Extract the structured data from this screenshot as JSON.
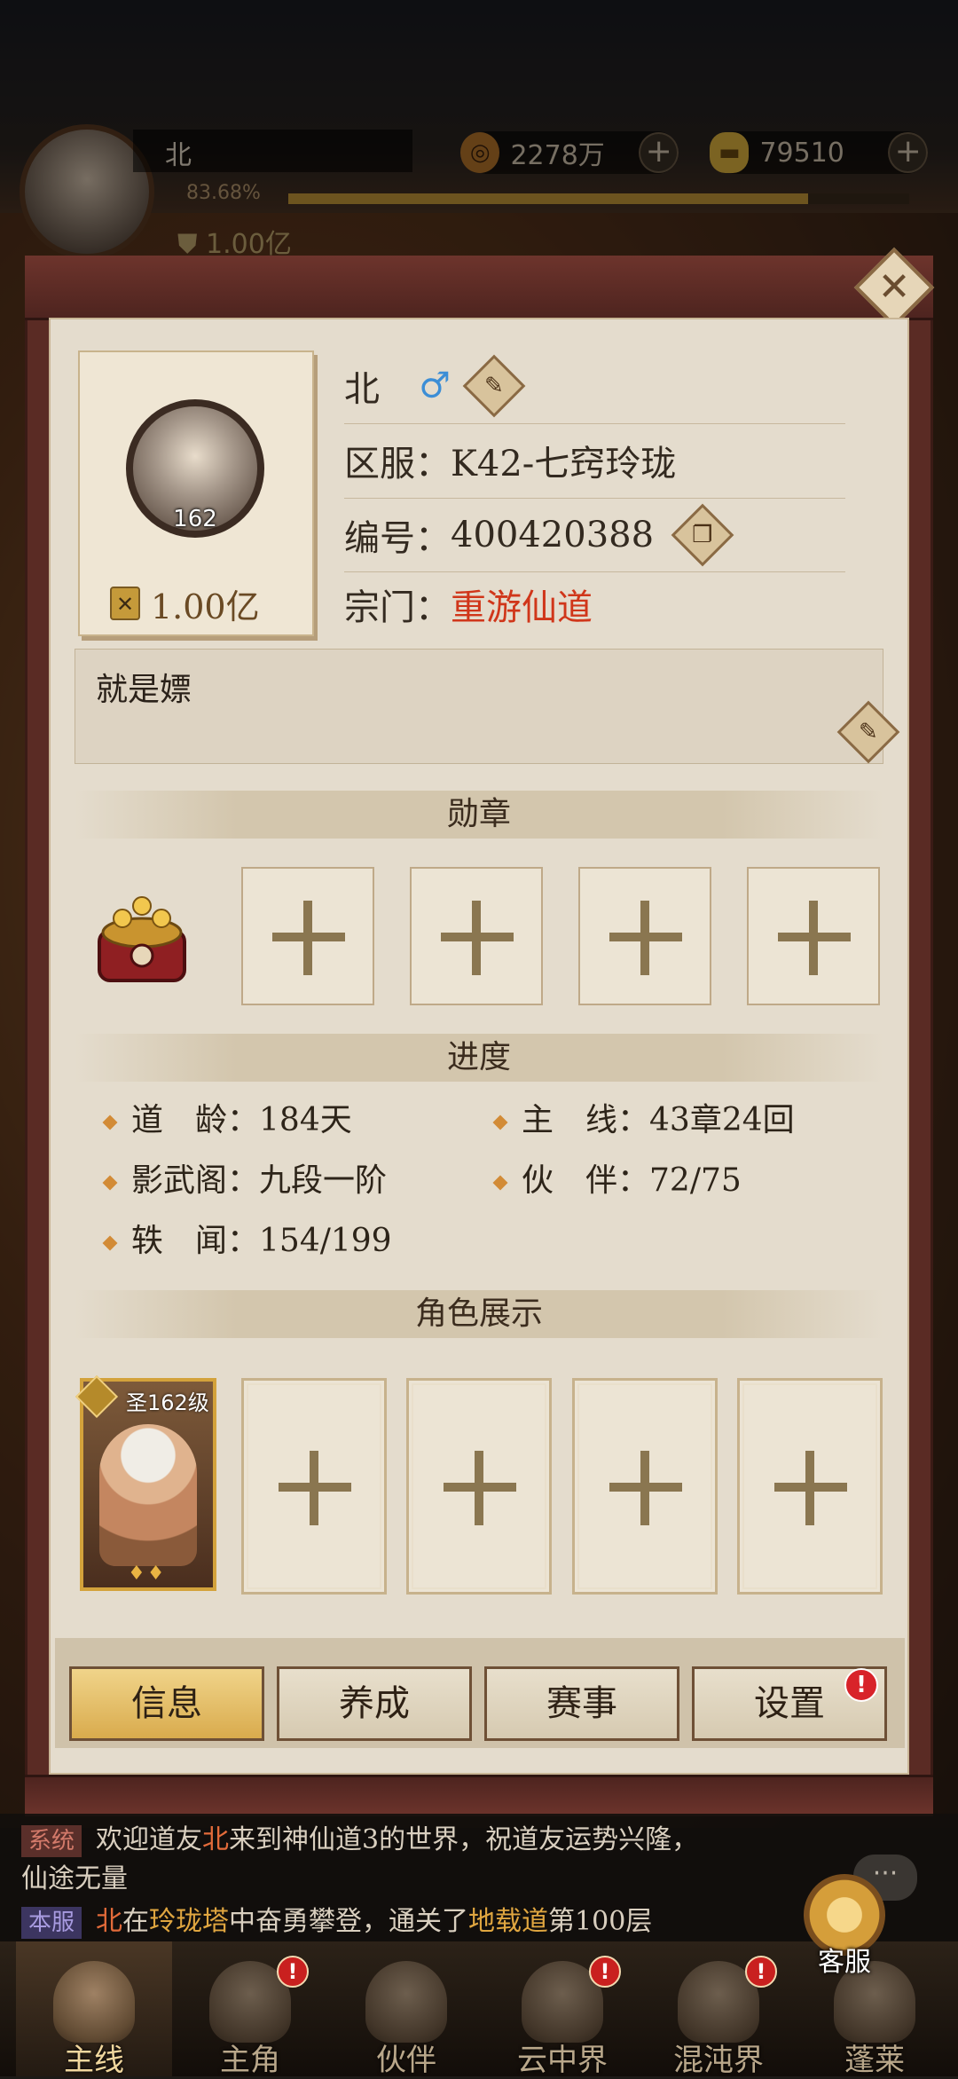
{
  "hud": {
    "name": "北",
    "exp_percent": "83.68%",
    "exp_fraction": 0.8368,
    "power": "1.00亿",
    "copper": "2278万",
    "gold": "79510"
  },
  "profile": {
    "level": "162",
    "power": "1.00亿",
    "name": "北",
    "gender_icon": "♂",
    "server_label": "区服：",
    "server_value": "K42-七窍玲珑",
    "id_label": "编号：",
    "id_value": "400420388",
    "sect_label": "宗门：",
    "sect_value": "重游仙道",
    "bio": "就是嫖"
  },
  "sections": {
    "medals": "勋章",
    "progress": "进度",
    "display": "角色展示"
  },
  "progress": [
    {
      "label": "道　龄：",
      "value": "184天"
    },
    {
      "label": "主　线：",
      "value": "43章24回"
    },
    {
      "label": "影武阁：",
      "value": "九段一阶"
    },
    {
      "label": "伙　伴：",
      "value": "72/75"
    },
    {
      "label": "轶　闻：",
      "value": "154/199"
    }
  ],
  "hero": {
    "level_label": "圣162级"
  },
  "tabs": [
    {
      "label": "信息",
      "active": true
    },
    {
      "label": "养成",
      "active": false
    },
    {
      "label": "赛事",
      "active": false
    },
    {
      "label": "设置",
      "active": false
    }
  ],
  "alert_mark": "!",
  "chat": {
    "line1": {
      "tag": "系统",
      "pre": "欢迎道友",
      "name": "北",
      "post": "来到神仙道3的世界，祝道友运势兴隆，"
    },
    "line2": "仙途无量",
    "line3": {
      "tag": "本服",
      "name": "北",
      "mid1": "在",
      "tower": "玲珑塔",
      "mid2": "中奋勇攀登，通关了",
      "dao": "地载道",
      "end": "第100层"
    }
  },
  "service": {
    "label": "客服",
    "bubble": "···"
  },
  "nav": [
    {
      "label": "主线",
      "active": true,
      "alert": false
    },
    {
      "label": "主角",
      "active": false,
      "alert": true
    },
    {
      "label": "伙伴",
      "active": false,
      "alert": false
    },
    {
      "label": "云中界",
      "active": false,
      "alert": true
    },
    {
      "label": "混沌界",
      "active": false,
      "alert": true
    },
    {
      "label": "蓬莱",
      "active": false,
      "alert": false
    }
  ],
  "colors": {
    "sect": "#d0361a",
    "gender": "#3c8ed6",
    "accent_gold": "#d9ab4d",
    "alert_red": "#d8232a"
  },
  "icons": {
    "copper": "coin-icon",
    "gold": "ingot-icon",
    "power": "power-shield-icon",
    "edit": "brush-edit-icon",
    "copy": "copy-icon",
    "close": "close-icon"
  }
}
